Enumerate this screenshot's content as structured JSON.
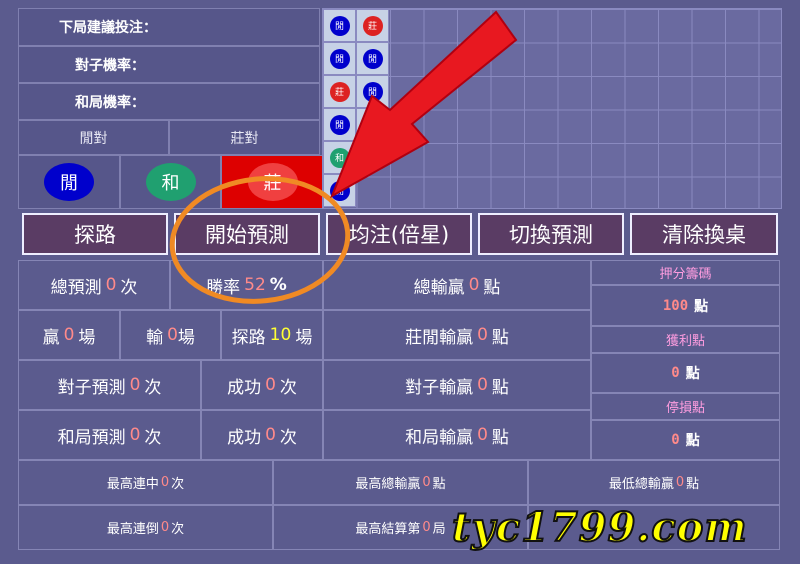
{
  "info": {
    "next_bet_label": "下局建議投注：",
    "pair_rate_label": "對子機率：",
    "tie_rate_label": "和局機率："
  },
  "pairs": {
    "player_pair_label": "閒對",
    "banker_pair_label": "莊對"
  },
  "bet_buttons": {
    "player": "閒",
    "tie": "和",
    "banker": "莊"
  },
  "bead_road": [
    [
      "閒",
      "莊"
    ],
    [
      "閒",
      "閒"
    ],
    [
      "莊",
      "閒"
    ],
    [
      "閒",
      "莊"
    ],
    [
      "和",
      ""
    ],
    [
      "閒",
      ""
    ]
  ],
  "actions": [
    "探路",
    "開始預測",
    "均注(倍星)",
    "切換預測",
    "清除換桌"
  ],
  "stats": {
    "total_predict": {
      "pre": "總預測",
      "val": "0",
      "post": "次"
    },
    "win_rate": {
      "pre": "勝率",
      "val": "52",
      "post": "%"
    },
    "total_win_loss": {
      "pre": "總輸贏",
      "val": "0",
      "post": "點"
    },
    "win": {
      "pre": "贏",
      "val": "0",
      "post": "場"
    },
    "lose": {
      "pre": "輸",
      "val": "0",
      "post": "場"
    },
    "probe": {
      "pre": "探路",
      "val": "10",
      "post": "場"
    },
    "banker_player_wl": {
      "pre": "莊閒輸贏",
      "val": "0",
      "post": "點"
    },
    "pair_predict": {
      "pre": "對子預測",
      "val": "0",
      "post": "次"
    },
    "pair_success": {
      "pre": "成功",
      "val": "0",
      "post": "次"
    },
    "pair_wl": {
      "pre": "對子輸贏",
      "val": "0",
      "post": "點"
    },
    "tie_predict": {
      "pre": "和局預測",
      "val": "0",
      "post": "次"
    },
    "tie_success": {
      "pre": "成功",
      "val": "0",
      "post": "次"
    },
    "tie_wl": {
      "pre": "和局輸贏",
      "val": "0",
      "post": "點"
    }
  },
  "side_panel": {
    "bet_chips_label": "押分籌碼",
    "bet_chips_value": "100",
    "bet_chips_unit": "點",
    "take_profit_label": "獲利點",
    "take_profit_value": "0",
    "take_profit_unit": "點",
    "stop_loss_label": "停損點",
    "stop_loss_value": "0",
    "stop_loss_unit": "點"
  },
  "records": {
    "max_win_streak": {
      "pre": "最高連中",
      "val": "0",
      "post": "次"
    },
    "max_total_wl": {
      "pre": "最高總輸贏",
      "val": "0",
      "post": "點"
    },
    "min_total_wl": {
      "pre": "最低總輸贏",
      "val": "0",
      "post": "點"
    },
    "max_lose_streak": {
      "pre": "最高連倒",
      "val": "0",
      "post": "次"
    },
    "max_settle": {
      "pre": "最高結算第",
      "val": "0",
      "post": "局"
    }
  },
  "watermark": "tyc1799.com",
  "colors": {
    "player": "#0000cc",
    "banker": "#dd0000",
    "tie": "#20a070",
    "highlight_ring": "#f08a24",
    "arrow": "#e81820"
  }
}
